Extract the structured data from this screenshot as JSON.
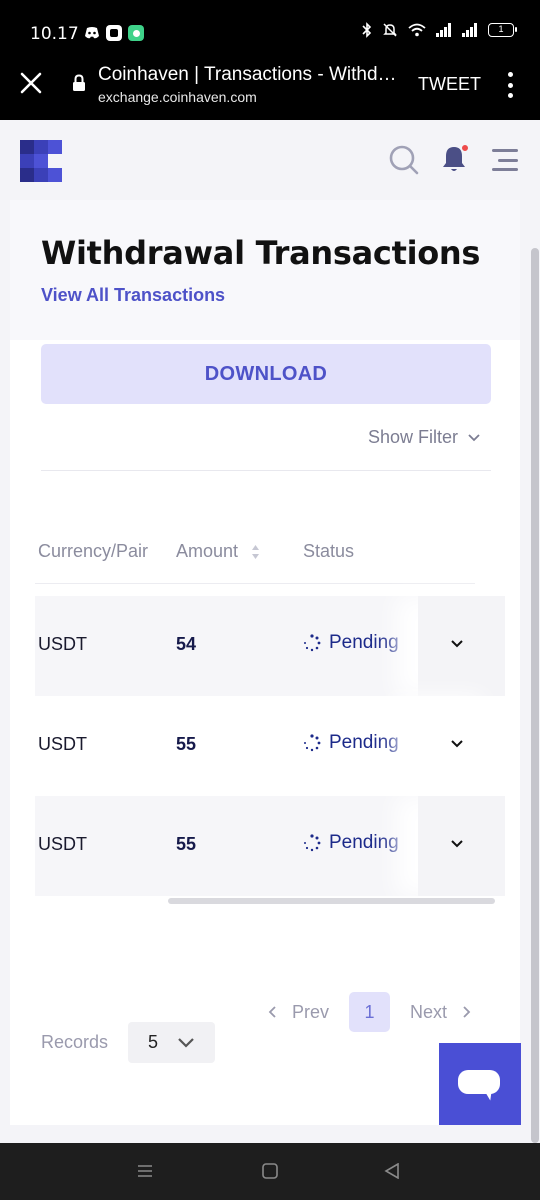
{
  "status_bar": {
    "time": "10.17",
    "battery": "1"
  },
  "browser": {
    "title": "Coinhaven | Transactions - Withdrawal",
    "url": "exchange.coinhaven.com",
    "tweet_label": "TWEET"
  },
  "page": {
    "heading": "Withdrawal Transactions",
    "view_all_link": "View All Transactions",
    "download_label": "DOWNLOAD",
    "show_filter_label": "Show Filter"
  },
  "table": {
    "headers": {
      "currency": "Currency/Pair",
      "amount": "Amount",
      "status": "Status"
    },
    "rows": [
      {
        "currency": "USDT",
        "amount": "54",
        "status": "Pending"
      },
      {
        "currency": "USDT",
        "amount": "55",
        "status": "Pending"
      },
      {
        "currency": "USDT",
        "amount": "55",
        "status": "Pending"
      }
    ]
  },
  "pagination": {
    "prev_label": "Prev",
    "current_page": "1",
    "next_label": "Next",
    "records_label": "Records",
    "records_value": "5"
  },
  "colors": {
    "brand": "#4a4fd5",
    "link": "#4e52c8",
    "status_pending": "#1c2a8a"
  },
  "icons": {
    "header": [
      "search-icon",
      "bell-icon",
      "menu-icon"
    ],
    "row_expand": "chevron-down-icon",
    "status": "spinner-icon",
    "chat": "chat-icon"
  }
}
